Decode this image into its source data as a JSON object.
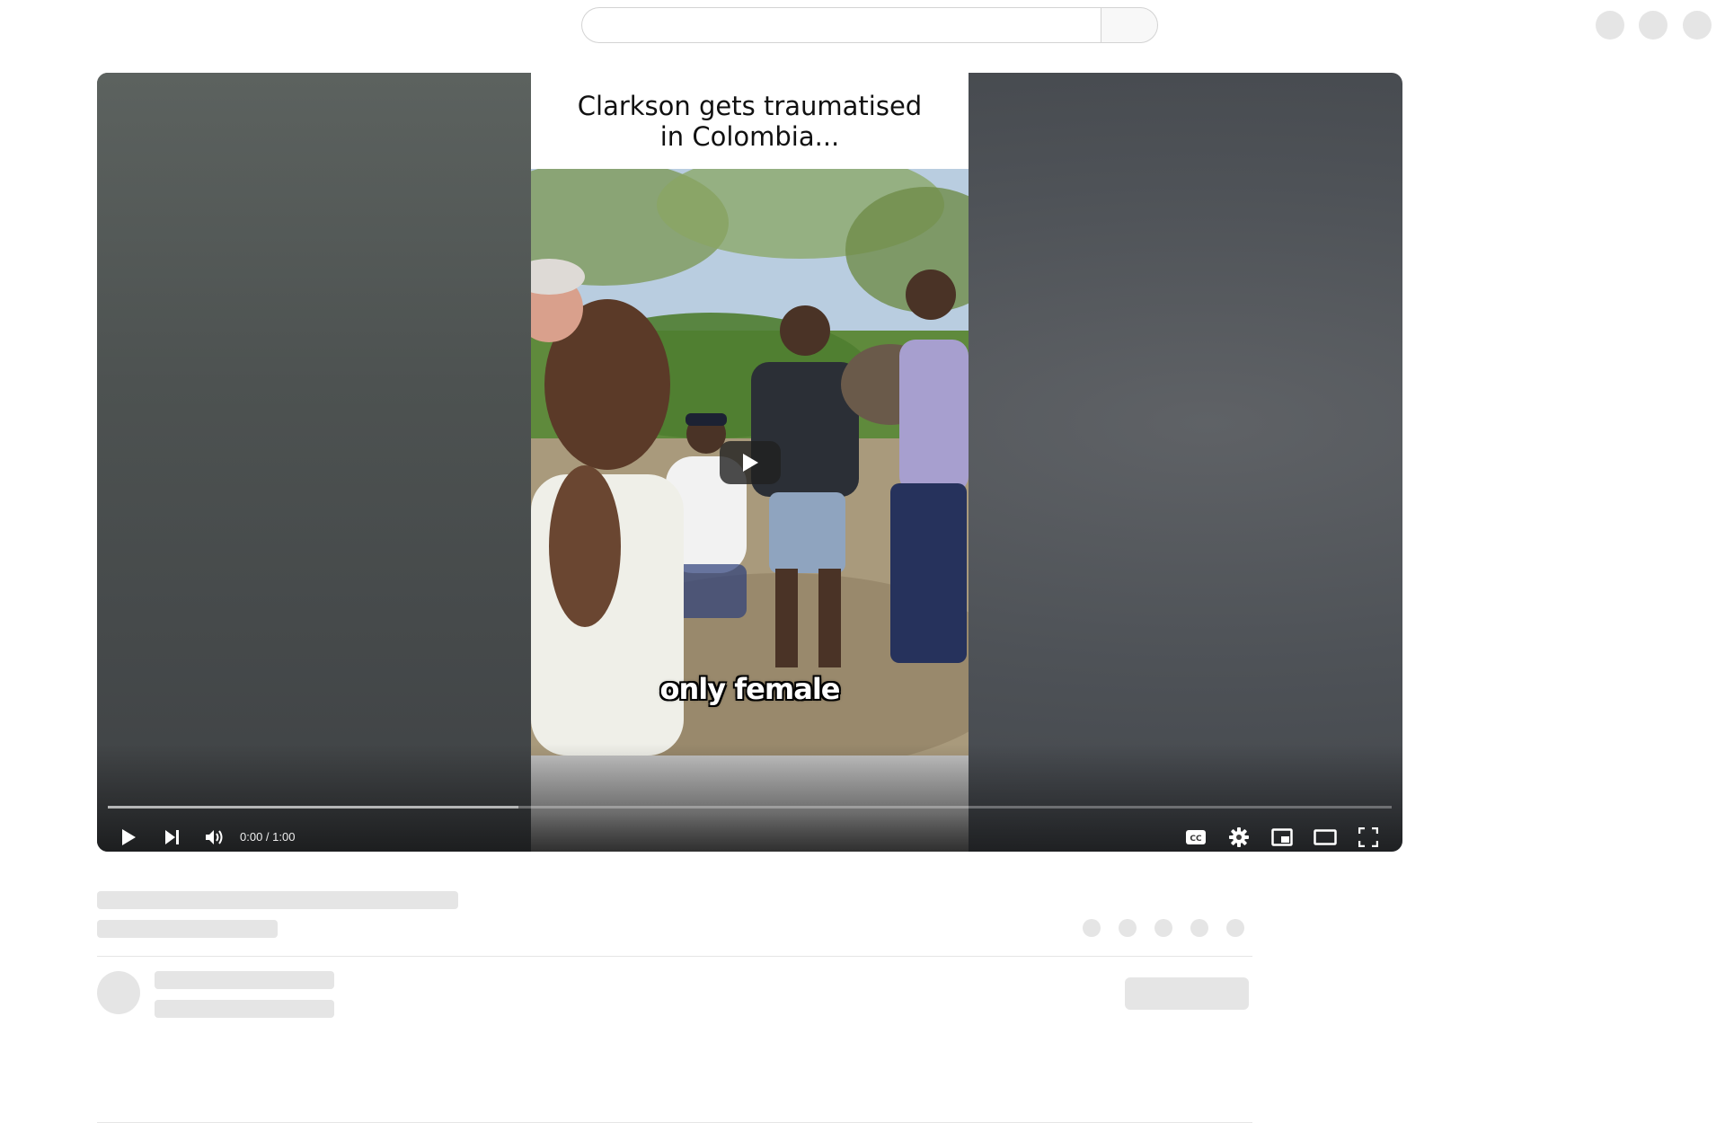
{
  "header": {
    "search": {
      "placeholder": "",
      "value": ""
    },
    "search_button_icon": "search-icon"
  },
  "player": {
    "video_title_overlay": "Clarkson gets traumatised\nin Colombia...",
    "caption": "only female",
    "time": "0:00 / 1:00",
    "progress": {
      "played": 0,
      "loaded": 0.32
    },
    "controls": {
      "play_icon": "play-icon",
      "next_icon": "next-icon",
      "volume_icon": "volume-icon",
      "captions_icon": "cc-icon",
      "settings_icon": "gear-icon",
      "miniplayer_icon": "miniplayer-icon",
      "theater_icon": "theater-icon",
      "fullscreen_icon": "fullscreen-icon"
    }
  },
  "colors": {
    "skeleton": "#e5e5e5",
    "control_icon": "#ffffff",
    "overlay_button": "#212121"
  }
}
